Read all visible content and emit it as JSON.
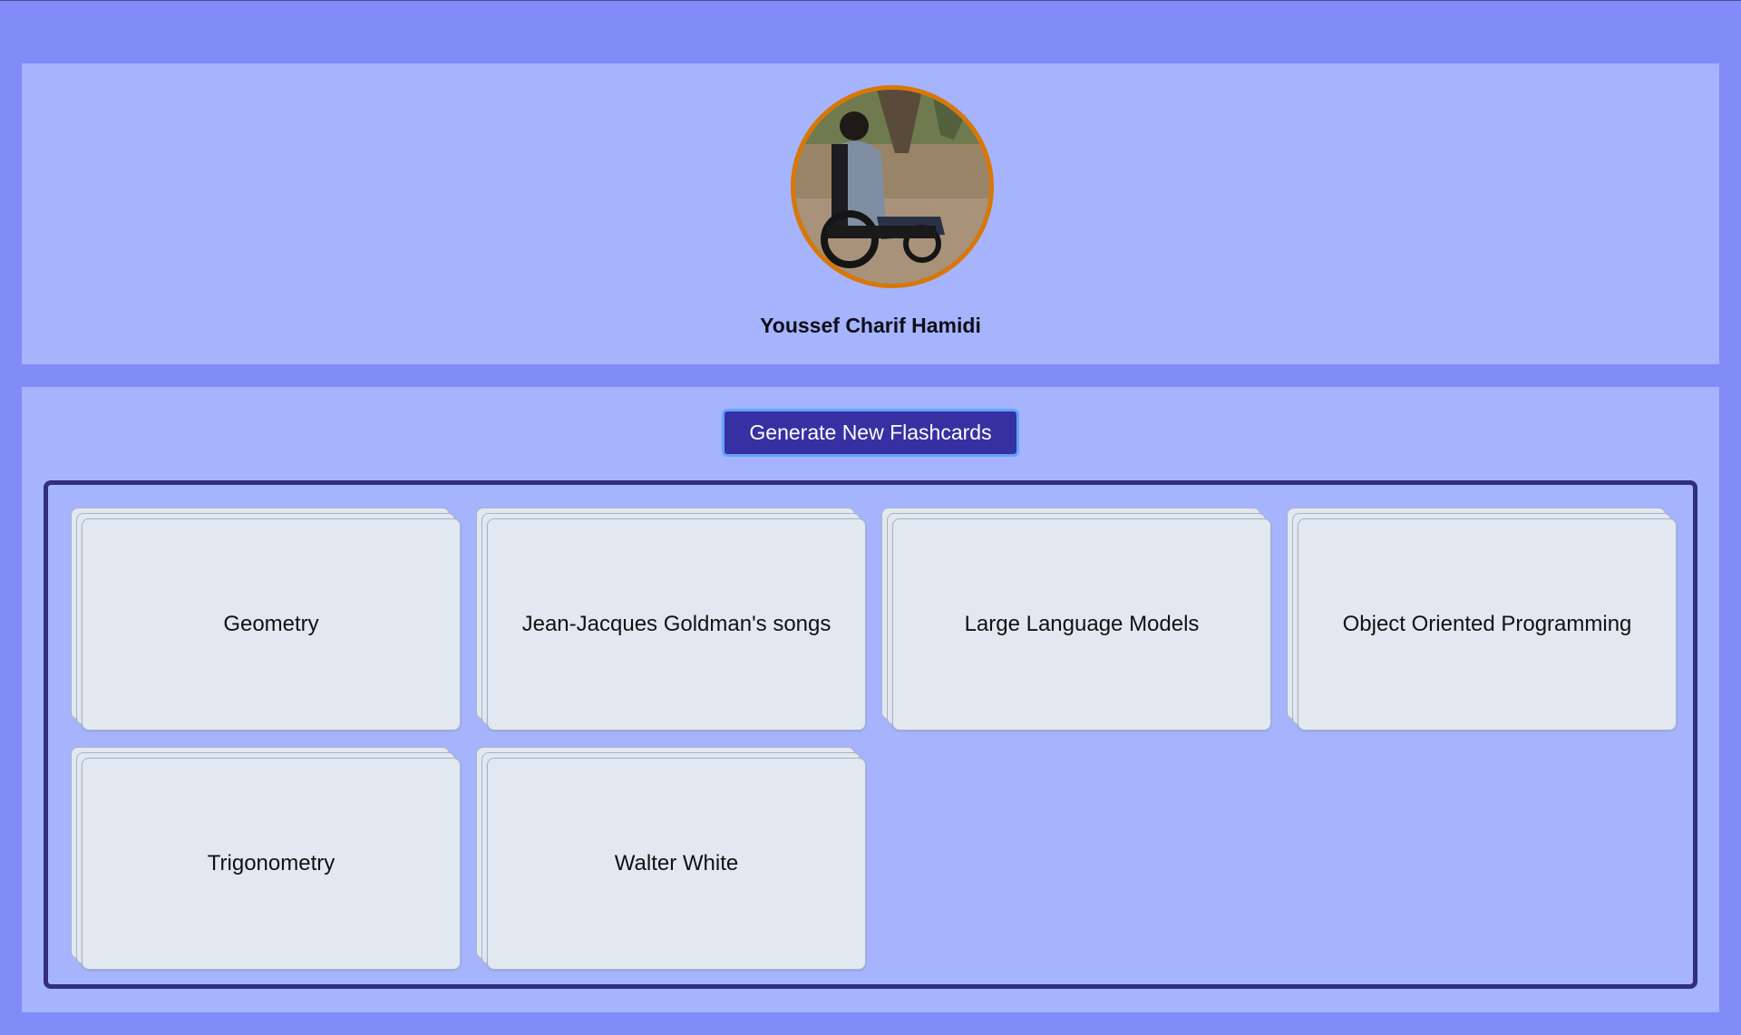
{
  "profile": {
    "name": "Youssef Charif Hamidi",
    "avatar_alt": "Profile photo"
  },
  "actions": {
    "generate_label": "Generate New Flashcards"
  },
  "decks": [
    {
      "title": "Geometry"
    },
    {
      "title": "Jean-Jacques Goldman's songs"
    },
    {
      "title": "Large Language Models"
    },
    {
      "title": "Object Oriented Programming"
    },
    {
      "title": "Trigonometry"
    },
    {
      "title": "Walter White"
    }
  ],
  "colors": {
    "page_background": "#818cf8",
    "panel_background": "#a5b4fc",
    "button_background": "#3730a3",
    "button_border": "#60a5fa",
    "grid_border": "#312e81",
    "card_background": "#e2e8f0",
    "avatar_ring": "#d97706"
  }
}
